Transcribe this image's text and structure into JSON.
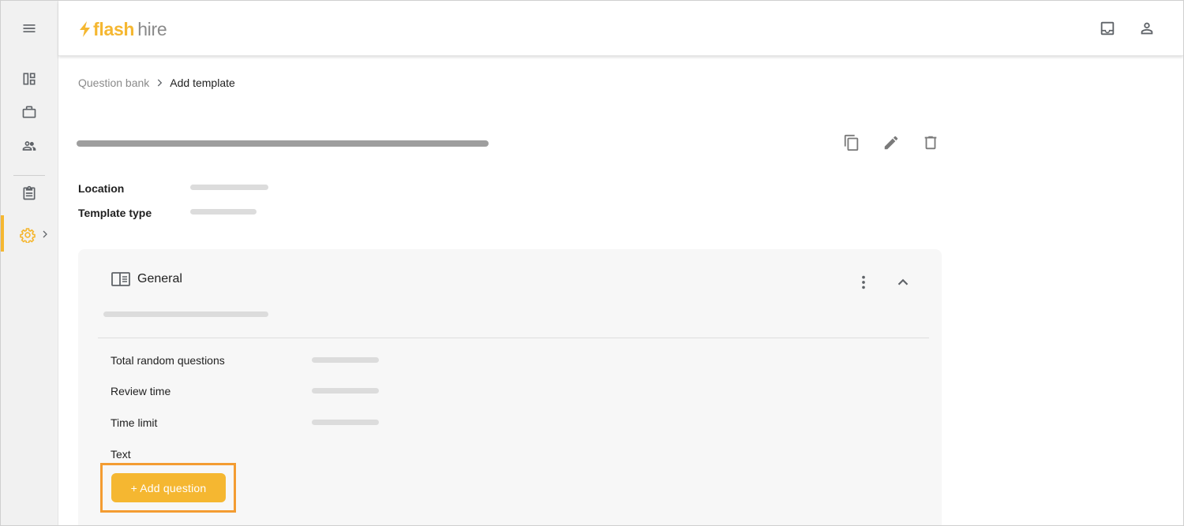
{
  "app": {
    "logo_part1": "flash",
    "logo_part2": "hire",
    "brand_color": "#f5b731"
  },
  "sidebar": {
    "items": [
      {
        "icon": "menu-icon"
      },
      {
        "icon": "dashboard-icon"
      },
      {
        "icon": "briefcase-icon"
      },
      {
        "icon": "people-icon"
      },
      {
        "icon": "clipboard-icon"
      },
      {
        "icon": "gear-icon",
        "active": true
      }
    ]
  },
  "header": {
    "icons": [
      "inbox-icon",
      "user-icon"
    ]
  },
  "breadcrumb": {
    "parent": "Question bank",
    "current": "Add template"
  },
  "template": {
    "actions": [
      "copy-icon",
      "edit-icon",
      "delete-icon"
    ],
    "fields": [
      {
        "label": "Location"
      },
      {
        "label": "Template type"
      }
    ]
  },
  "section": {
    "title": "General",
    "rows": [
      {
        "label": "Total random questions"
      },
      {
        "label": "Review time"
      },
      {
        "label": "Time limit"
      },
      {
        "label": "Text"
      }
    ],
    "add_question_label": "+ Add question"
  },
  "colors": {
    "accent": "#f5b731",
    "highlight_outline": "#f39c32",
    "skeleton": "#dcdcdc"
  }
}
